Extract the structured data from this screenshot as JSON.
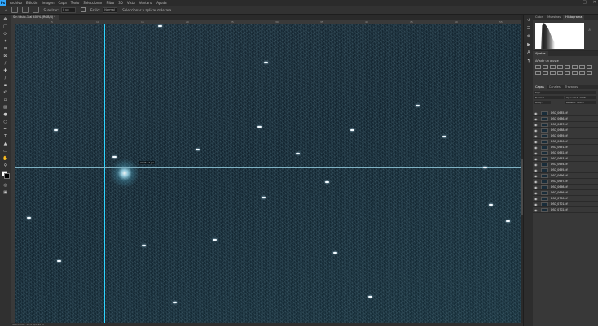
{
  "menubar": {
    "logo": "Ps",
    "items": [
      "Archivo",
      "Edición",
      "Imagen",
      "Capa",
      "Texto",
      "Seleccionar",
      "Filtro",
      "3D",
      "Vista",
      "Ventana",
      "Ayuda"
    ]
  },
  "options": {
    "feather_label": "Suavizar:",
    "feather_value": "0 px",
    "style_label": "Estilo:",
    "style_value": "Normal",
    "select_mask_label": "Seleccionar y aplicar máscara..."
  },
  "document": {
    "tab_title": "Sin título-1 al 400% (RGB/8) *",
    "status_text": "400%     Doc: 10,4 M/8,92 M"
  },
  "ruler": {
    "top_numbers": [
      "5",
      "10",
      "15",
      "20",
      "25",
      "30",
      "35",
      "40",
      "45",
      "50",
      "55"
    ]
  },
  "panels": {
    "top_tabs": [
      "Color",
      "Muestras",
      "Histograma"
    ],
    "adjust_tabs": [
      "Ajustes"
    ],
    "adjust_title": "Añadir un ajuste",
    "layer_tabs": [
      "Capas",
      "Canales",
      "Trazados"
    ],
    "kind_label": "Tipo",
    "blend_mode": "Normal",
    "opacity_label": "Opacidad: 100%",
    "fill_label": "Relleno: 100%",
    "lock_label": "Bloq.:"
  },
  "layers": [
    "DSC_0685.tif",
    "DSC_0686.tif",
    "DSC_0687.tif",
    "DSC_0688.tif",
    "DSC_0689.tif",
    "DSC_0690.tif",
    "DSC_0691.tif",
    "DSC_0692.tif",
    "DSC_0693.tif",
    "DSC_0694.tif",
    "DSC_0695.tif",
    "DSC_0696.tif",
    "DSC_0697.tif",
    "DSC_0698.tif",
    "DSC_0699.tif",
    "DSC_0700.tif",
    "DSC_0701.tif",
    "DSC_0702.tif"
  ],
  "canvas": {
    "background_color": "#16293a",
    "guide_color": "#2fd4ff",
    "coord_readout": "Anch.: 1 px"
  }
}
